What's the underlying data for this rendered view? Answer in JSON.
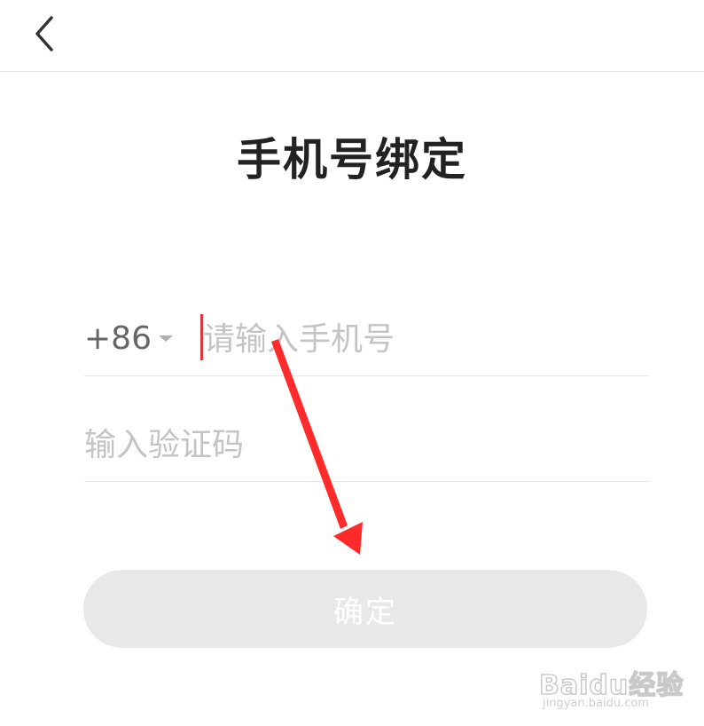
{
  "header": {
    "back_icon": "chevron-left-icon"
  },
  "page": {
    "title": "手机号绑定"
  },
  "phone": {
    "country_code": "+86",
    "dropdown_icon": "caret-down-icon",
    "value": "",
    "placeholder": "请输入手机号"
  },
  "code": {
    "value": "",
    "placeholder": "输入验证码"
  },
  "confirm": {
    "label": "确定"
  },
  "annotation": {
    "arrow_color": "#ff2a2a"
  },
  "watermark": {
    "logo": "Baidu经验",
    "url": "jingyan.baidu.com"
  },
  "colors": {
    "caret": "#d9363e",
    "button_bg": "#e8e8e8",
    "placeholder": "#c4c4c4"
  }
}
